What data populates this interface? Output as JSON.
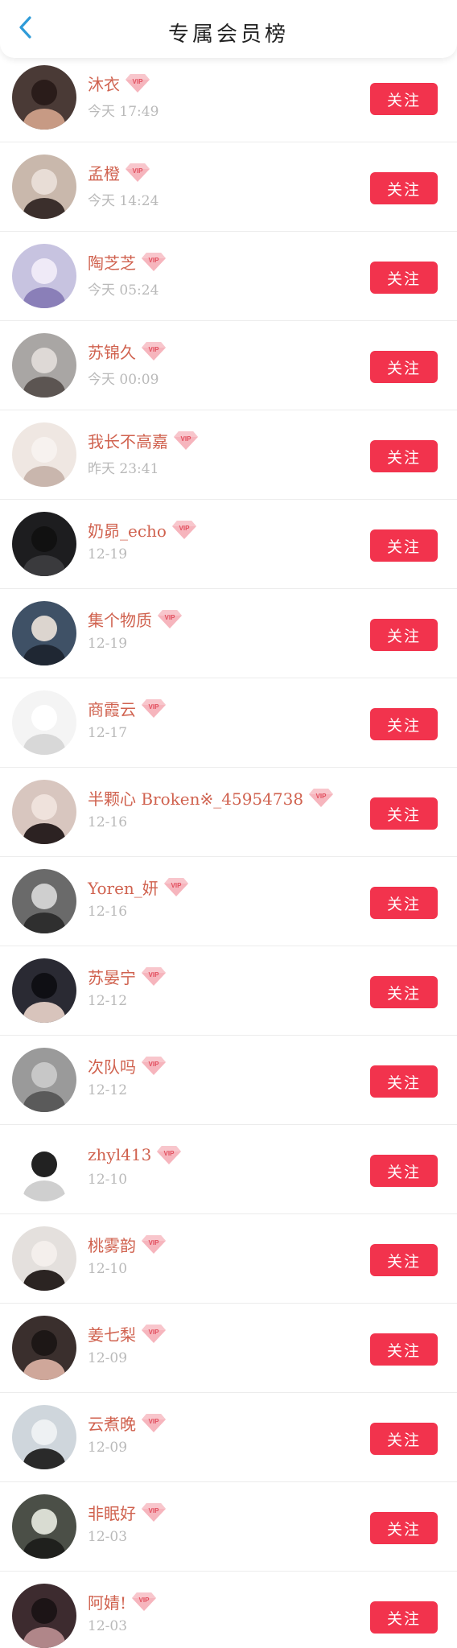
{
  "header": {
    "title": "专属会员榜"
  },
  "colors": {
    "accent": "#f2334d",
    "back": "#2f9bd8",
    "name": "#d0624f",
    "time": "#b9b9b9"
  },
  "badge_text": "VIP",
  "follow_label": "关注",
  "members": [
    {
      "name": "沐衣",
      "time": "今天 17:49"
    },
    {
      "name": "孟橙",
      "time": "今天 14:24"
    },
    {
      "name": "陶芝芝",
      "time": "今天 05:24"
    },
    {
      "name": "苏锦久",
      "time": "今天 00:09"
    },
    {
      "name": "我长不高嘉",
      "time": "昨天 23:41"
    },
    {
      "name": "奶昴_echo",
      "time": "12-19"
    },
    {
      "name": "集个物质",
      "time": "12-19"
    },
    {
      "name": "商霞云",
      "time": "12-17"
    },
    {
      "name": "半颗心 Broken※_45954738",
      "time": "12-16"
    },
    {
      "name": "Yoren_妍",
      "time": "12-16"
    },
    {
      "name": "苏晏宁",
      "time": "12-12"
    },
    {
      "name": "次队吗",
      "time": "12-12"
    },
    {
      "name": "zhyl413",
      "time": "12-10"
    },
    {
      "name": "桃雾韵",
      "time": "12-10"
    },
    {
      "name": "姜七梨",
      "time": "12-09"
    },
    {
      "name": "云煮晚",
      "time": "12-09"
    },
    {
      "name": "非眠好",
      "time": "12-03"
    },
    {
      "name": "阿婧!",
      "time": "12-03"
    }
  ]
}
